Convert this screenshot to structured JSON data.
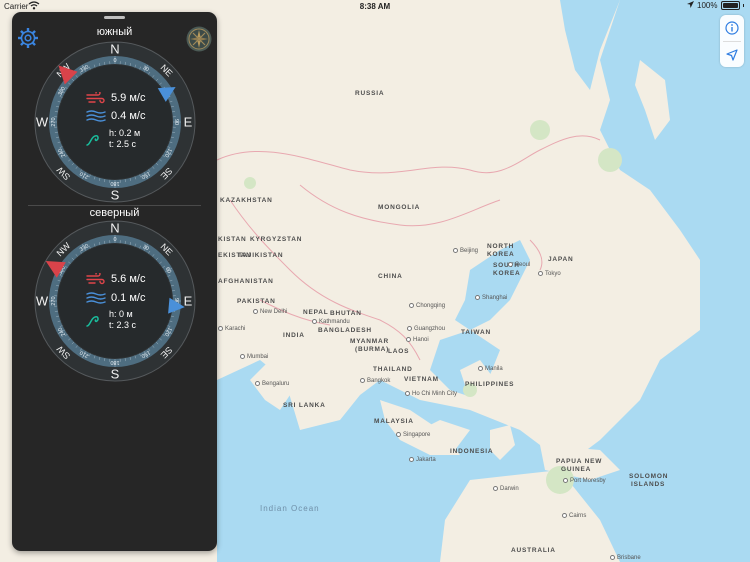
{
  "status_bar": {
    "carrier": "Carrier",
    "time": "8:38 AM",
    "battery": "100%"
  },
  "map": {
    "countries": [
      "RUSSIA",
      "KAZAKHSTAN",
      "MONGOLIA",
      "CHINA",
      "KYRGYZSTAN",
      "TAJIKISTAN",
      "AFGHANISTAN",
      "PAKISTAN",
      "NEPAL",
      "BHUTAN",
      "INDIA",
      "BANGLADESH",
      "MYANMAR",
      "(BURMA)",
      "LAOS",
      "THAILAND",
      "VIETNAM",
      "NORTH",
      "KOREA",
      "SOUTH",
      "KOREA",
      "JAPAN",
      "TAIWAN",
      "PHILIPPINES",
      "SRI LANKA",
      "MALAYSIA",
      "INDONESIA",
      "PAPUA NEW",
      "GUINEA",
      "SOLOMON",
      "ISLANDS",
      "AUSTRALIA",
      "KISTAN",
      "EKISTAN"
    ],
    "cities": [
      "Beijing",
      "Seoul",
      "Tokyo",
      "Shanghai",
      "Chongqing",
      "Guangzhou",
      "Hanoi",
      "Manila",
      "Bangkok",
      "Ho Chi Minh City",
      "Singapore",
      "Jakarta",
      "Port Moresby",
      "Darwin",
      "Cairns",
      "Brisbane",
      "New Delhi",
      "Karachi",
      "Mumbai",
      "Bengaluru",
      "Kathmandu"
    ],
    "ocean": "Indian Ocean"
  },
  "panel": {
    "stations": [
      {
        "name": "южный",
        "cardinals": {
          "n": "N",
          "e": "E",
          "s": "S",
          "w": "W",
          "ne": "NE",
          "se": "SE",
          "sw": "SW",
          "nw": "NW"
        },
        "degrees": [
          "0",
          "30",
          "60",
          "90",
          "120",
          "150",
          "180",
          "210",
          "240",
          "270",
          "300",
          "330"
        ],
        "wind_dir_deg": 315,
        "wave_dir_deg": 60,
        "wind_speed": "5.9 м/с",
        "current_speed": "0.4 м/с",
        "tide_height": "h: 0.2 м",
        "tide_period": "t: 2.5 с"
      },
      {
        "name": "северный",
        "cardinals": {
          "n": "N",
          "e": "E",
          "s": "S",
          "w": "W",
          "ne": "NE",
          "se": "SE",
          "sw": "SW",
          "nw": "NW"
        },
        "degrees": [
          "0",
          "30",
          "60",
          "90",
          "120",
          "150",
          "180",
          "210",
          "240",
          "270",
          "300",
          "330"
        ],
        "wind_dir_deg": 300,
        "wave_dir_deg": 95,
        "wind_speed": "5.6 м/с",
        "current_speed": "0.1 м/с",
        "tide_height": "h: 0 м",
        "tide_period": "t: 2.3 с"
      }
    ]
  },
  "colors": {
    "panel_bg": "#262626",
    "wind_red": "#e0454a",
    "wave_blue": "#4a90d9",
    "tide_teal": "#1abc9c",
    "accent": "#2f7de1"
  }
}
